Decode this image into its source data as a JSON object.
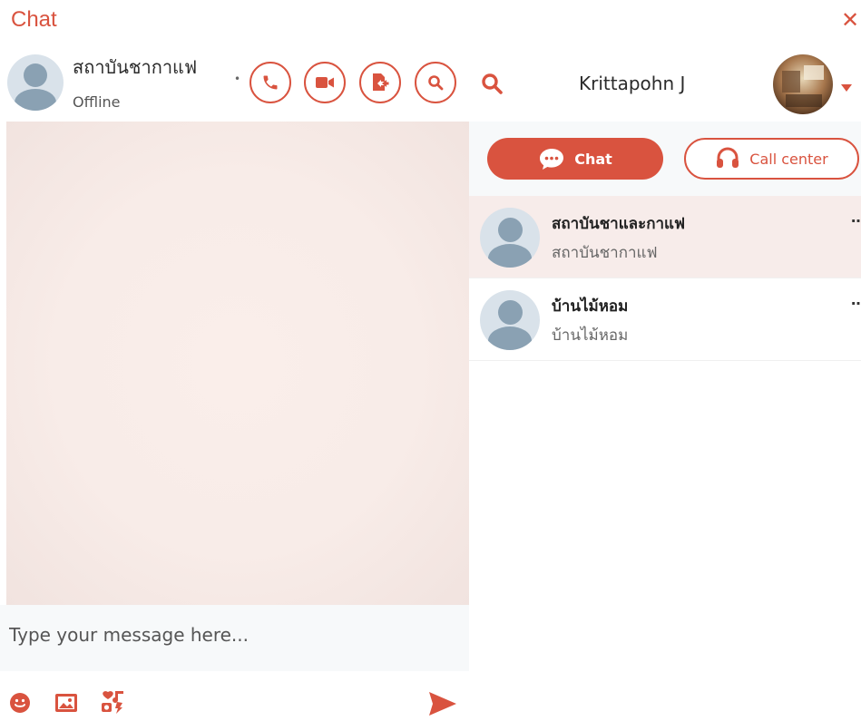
{
  "window": {
    "title": "Chat",
    "close_glyph": "✕"
  },
  "active_chat": {
    "name": "สถาบันชากาแฟ",
    "status": "Offline",
    "actions": [
      {
        "name": "phone-icon",
        "label": "call"
      },
      {
        "name": "video-icon",
        "label": "video"
      },
      {
        "name": "share-file-icon",
        "label": "share"
      },
      {
        "name": "search-icon",
        "label": "search"
      }
    ]
  },
  "composer": {
    "placeholder": "Type your message here...",
    "tools": [
      "emoji-icon",
      "image-icon",
      "media-icon"
    ],
    "send_icon": "send-icon"
  },
  "user": {
    "name": "Krittapohn J"
  },
  "tabs": [
    {
      "label": "Chat",
      "active": true,
      "icon": "chat-bubble-icon"
    },
    {
      "label": "Call center",
      "active": false,
      "icon": "headset-icon"
    }
  ],
  "conversations": [
    {
      "title": "สถาบันชาและกาแฟ",
      "subtitle": "สถาบันชากาแฟ",
      "more": "…",
      "selected": true
    },
    {
      "title": "บ้านไม้หอม",
      "subtitle": "บ้านไม้หอม",
      "more": "…",
      "selected": false
    }
  ],
  "colors": {
    "accent": "#d9533f",
    "chat_bg": "#f8ece8",
    "panel_bg": "#f7f9fa"
  }
}
